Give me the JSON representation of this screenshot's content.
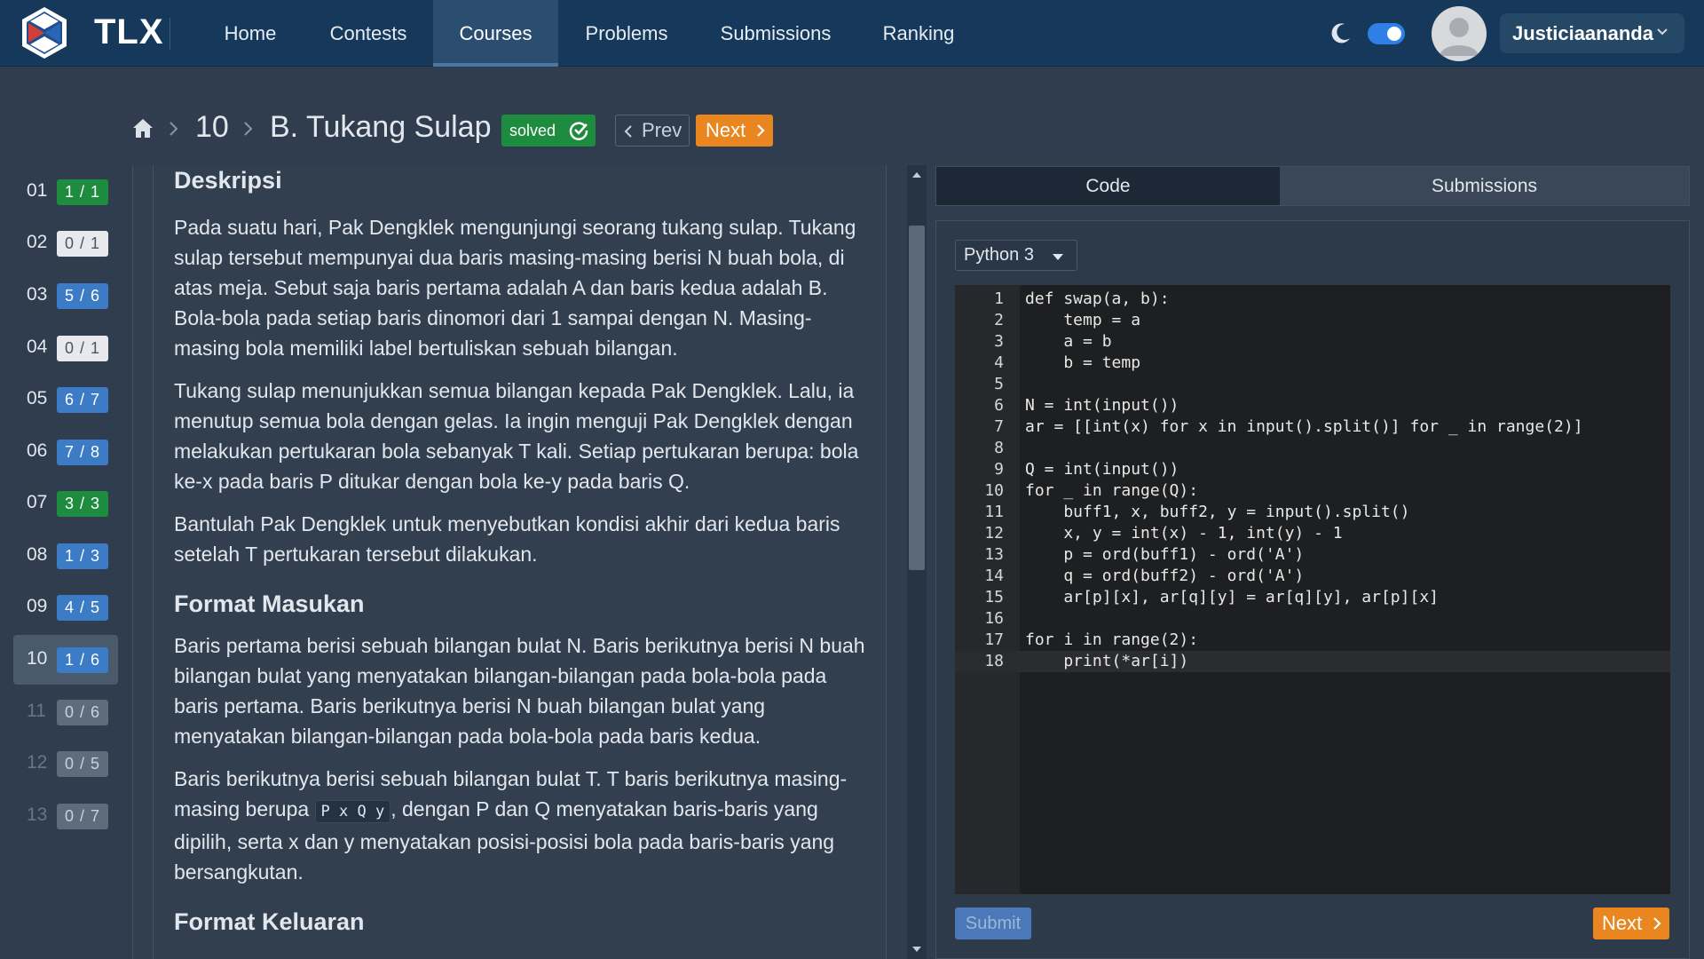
{
  "navbar": {
    "brand": "TLX",
    "items": [
      {
        "label": "Home"
      },
      {
        "label": "Contests"
      },
      {
        "label": "Courses"
      },
      {
        "label": "Problems"
      },
      {
        "label": "Submissions"
      },
      {
        "label": "Ranking"
      }
    ],
    "active_item": "Courses",
    "dark_mode_on": true,
    "username": "Justiciaananda"
  },
  "breadcrumb": {
    "chapter": "10",
    "title": "B. Tukang Sulap",
    "status": "solved",
    "prev_label": "Prev",
    "next_label": "Next"
  },
  "problems": [
    {
      "num": "01",
      "score": "1 / 1",
      "status": "green"
    },
    {
      "num": "02",
      "score": "0 / 1",
      "status": "gray"
    },
    {
      "num": "03",
      "score": "5 / 6",
      "status": "blue"
    },
    {
      "num": "04",
      "score": "0 / 1",
      "status": "gray"
    },
    {
      "num": "05",
      "score": "6 / 7",
      "status": "blue"
    },
    {
      "num": "06",
      "score": "7 / 8",
      "status": "blue"
    },
    {
      "num": "07",
      "score": "3 / 3",
      "status": "green"
    },
    {
      "num": "08",
      "score": "1 / 3",
      "status": "blue"
    },
    {
      "num": "09",
      "score": "4 / 5",
      "status": "blue"
    },
    {
      "num": "10",
      "score": "1 / 6",
      "status": "blue"
    },
    {
      "num": "11",
      "score": "0 / 6",
      "status": "dim"
    },
    {
      "num": "12",
      "score": "0 / 5",
      "status": "dim"
    },
    {
      "num": "13",
      "score": "0 / 7",
      "status": "dim"
    }
  ],
  "active_problem": "10",
  "description": {
    "title": "Deskripsi",
    "p1": "Pada suatu hari, Pak Dengklek mengunjungi seorang tukang sulap. Tukang sulap tersebut mempunyai dua baris masing-masing berisi N buah bola, di atas meja. Sebut saja baris pertama adalah A dan baris kedua adalah B. Bola-bola pada setiap baris dinomori dari 1 sampai dengan N. Masing-masing bola memiliki label bertuliskan sebuah bilangan.",
    "p2": "Tukang sulap menunjukkan semua bilangan kepada Pak Dengklek. Lalu, ia menutup semua bola dengan gelas. Ia ingin menguji Pak Dengklek dengan melakukan pertukaran bola sebanyak T kali. Setiap pertukaran berupa: bola ke-x pada baris P ditukar dengan bola ke-y pada baris Q.",
    "p3": "Bantulah Pak Dengklek untuk menyebutkan kondisi akhir dari kedua baris setelah T pertukaran tersebut dilakukan.",
    "input_title": "Format Masukan",
    "input_p1": "Baris pertama berisi sebuah bilangan bulat N. Baris berikutnya berisi N buah bilangan bulat yang menyatakan bilangan-bilangan pada bola-bola pada baris pertama. Baris berikutnya berisi N buah bilangan bulat yang menyatakan bilangan-bilangan pada bola-bola pada baris kedua.",
    "input_p2_a": "Baris berikutnya berisi sebuah bilangan bulat T. T baris berikutnya masing-masing berupa ",
    "input_p2_code": "P x Q y",
    "input_p2_b": ", dengan P dan Q menyatakan baris-baris yang dipilih, serta x dan y menyatakan posisi-posisi bola pada baris-baris yang bersangkutan.",
    "output_title": "Format Keluaran"
  },
  "tabs": [
    {
      "label": "Code"
    },
    {
      "label": "Submissions"
    }
  ],
  "active_tab": "Code",
  "language": "Python 3",
  "code_lines": [
    "def swap(a, b):",
    "    temp = a",
    "    a = b",
    "    b = temp",
    "",
    "N = int(input())",
    "ar = [[int(x) for x in input().split()] for _ in range(2)]",
    "",
    "Q = int(input())",
    "for _ in range(Q):",
    "    buff1, x, buff2, y = input().split()",
    "    x, y = int(x) - 1, int(y) - 1",
    "    p = ord(buff1) - ord('A')",
    "    q = ord(buff2) - ord('A')",
    "    ar[p][x], ar[q][y] = ar[q][y], ar[p][x]",
    "",
    "for i in range(2):",
    "    print(*ar[i])"
  ],
  "line_numbers": [
    "1",
    "2",
    "3",
    "4",
    "5",
    "6",
    "7",
    "8",
    "9",
    "10",
    "11",
    "12",
    "13",
    "14",
    "15",
    "16",
    "17",
    "18"
  ],
  "current_line": 18,
  "submit_label": "Submit",
  "next_label": "Next",
  "colors": {
    "navbar": "#15385b",
    "accent_orange": "#e9861f",
    "solved_green": "#1e8c3f",
    "score_blue": "#3c7bc6"
  }
}
